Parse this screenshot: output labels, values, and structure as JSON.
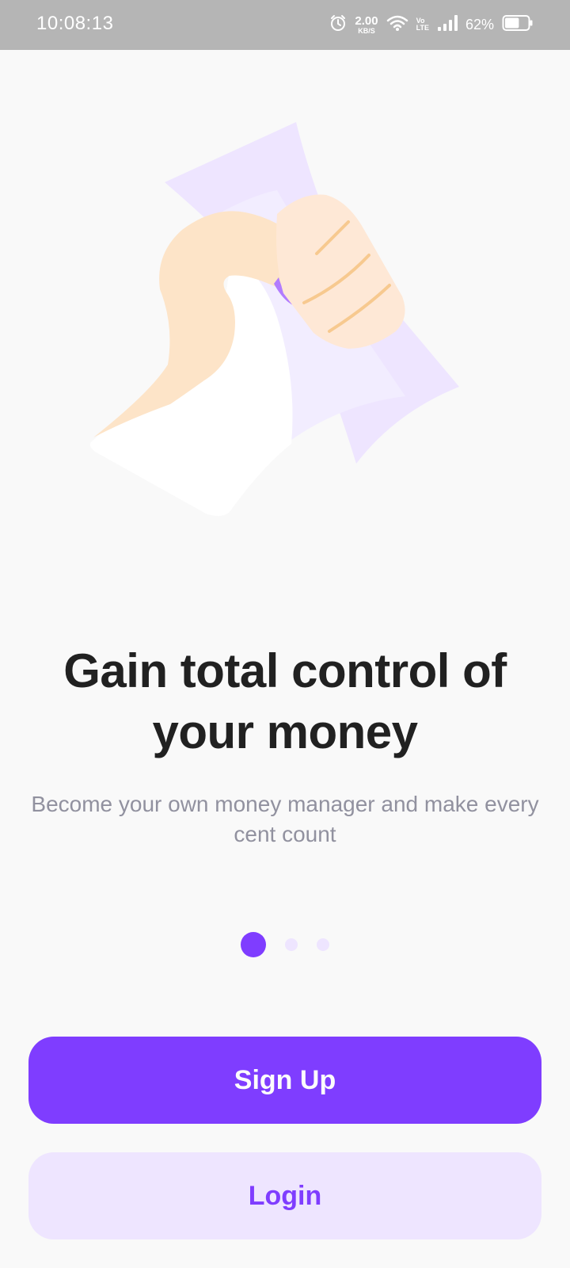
{
  "status_bar": {
    "time": "10:08:13",
    "net_speed_value": "2.00",
    "net_speed_unit": "KB/S",
    "volte_top": "Vo",
    "volte_bottom": "LTE",
    "battery_percent": "62%",
    "battery_level": 0.62,
    "icons": [
      "alarm-icon",
      "wifi-icon",
      "signal-icon",
      "battery-icon"
    ]
  },
  "onboarding": {
    "illustration": "hand-holding-receipts",
    "title": "Gain total control of your money",
    "subtitle": "Become your own money manager and make every cent count",
    "pager": {
      "total": 3,
      "active_index": 0
    }
  },
  "actions": {
    "signup_label": "Sign Up",
    "login_label": "Login"
  },
  "colors": {
    "primary": "#7f3dff",
    "primary_light": "#eee5ff",
    "title_text": "#212121",
    "subtitle_text": "#91919f",
    "status_bar_bg": "#b5b5b5",
    "background": "#f9f9f9"
  }
}
